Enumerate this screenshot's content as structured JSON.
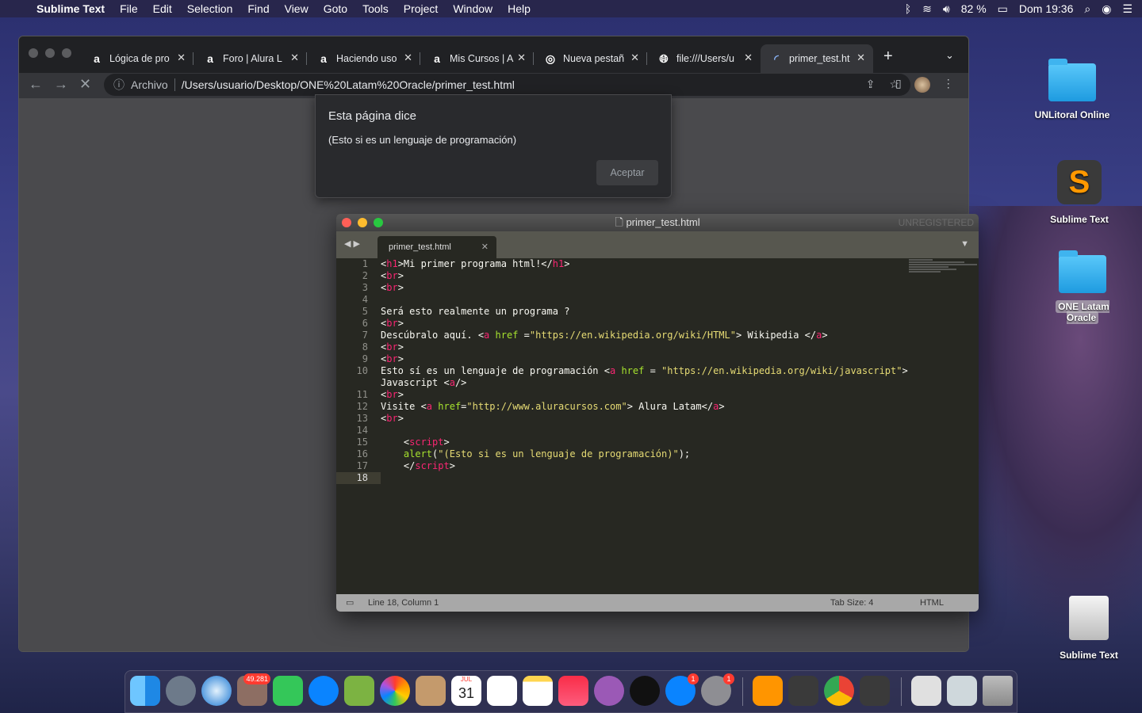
{
  "menubar": {
    "app": "Sublime Text",
    "items": [
      "File",
      "Edit",
      "Selection",
      "Find",
      "View",
      "Goto",
      "Tools",
      "Project",
      "Window",
      "Help"
    ],
    "battery": "82 %",
    "clock": "Dom 19:36"
  },
  "browser": {
    "tabs": [
      {
        "title": "Lógica de pro"
      },
      {
        "title": "Foro | Alura L"
      },
      {
        "title": "Haciendo uso"
      },
      {
        "title": "Mis Cursos | A"
      },
      {
        "title": "Nueva pestañ"
      },
      {
        "title": "file:///Users/u"
      },
      {
        "title": "primer_test.ht"
      }
    ],
    "url_scheme": "Archivo",
    "url": "/Users/usuario/Desktop/ONE%20Latam%20Oracle/primer_test.html"
  },
  "alert": {
    "title": "Esta página dice",
    "message": "(Esto si es un lenguaje de programación)",
    "button": "Aceptar"
  },
  "sublime": {
    "title": "primer_test.html",
    "unregistered": "UNREGISTERED",
    "tab": "primer_test.html",
    "status_position": "Line 18, Column 1",
    "status_tabsize": "Tab Size: 4",
    "status_syntax": "HTML"
  },
  "desktop": {
    "icons": [
      "UNLitoral Online",
      "Sublime Text",
      "ONE Latam Oracle",
      "Sublime Text"
    ]
  },
  "dock": {
    "mail_badge": "49.281",
    "appstore_badge": "1",
    "prefs_badge": "1",
    "calendar_month": "JUL",
    "calendar_day": "31"
  }
}
